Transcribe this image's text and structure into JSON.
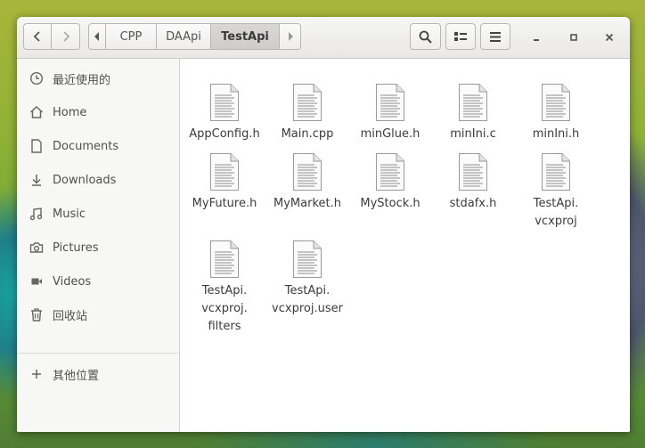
{
  "window": {
    "nav": {
      "back_icon": "chevron-left-icon",
      "forward_icon": "chevron-right-icon"
    },
    "path": [
      "CPP",
      "DAApi",
      "TestApi"
    ],
    "toolbar": {
      "search_icon": "search-icon",
      "view_icon": "list-view-icon",
      "menu_icon": "hamburger-menu-icon"
    },
    "controls": {
      "minimize_icon": "minimize-icon",
      "maximize_icon": "maximize-icon",
      "close_icon": "close-icon"
    }
  },
  "sidebar": {
    "items": [
      {
        "label": "最近使用的",
        "icon": "clock-icon"
      },
      {
        "label": "Home",
        "icon": "home-icon"
      },
      {
        "label": "Documents",
        "icon": "document-icon"
      },
      {
        "label": "Downloads",
        "icon": "download-icon"
      },
      {
        "label": "Music",
        "icon": "music-icon"
      },
      {
        "label": "Pictures",
        "icon": "camera-icon"
      },
      {
        "label": "Videos",
        "icon": "video-icon"
      },
      {
        "label": "回收站",
        "icon": "trash-icon"
      }
    ],
    "other": {
      "label": "其他位置",
      "icon": "plus-icon"
    }
  },
  "files": [
    {
      "lines": [
        "AppConfig.h"
      ]
    },
    {
      "lines": [
        "Main.cpp"
      ]
    },
    {
      "lines": [
        "minGlue.h"
      ]
    },
    {
      "lines": [
        "minIni.c"
      ]
    },
    {
      "lines": [
        "minIni.h"
      ]
    },
    {
      "lines": [
        "MyFuture.h"
      ]
    },
    {
      "lines": [
        "MyMarket.h"
      ]
    },
    {
      "lines": [
        "MyStock.h"
      ]
    },
    {
      "lines": [
        "stdafx.h"
      ]
    },
    {
      "lines": [
        "TestApi.",
        "vcxproj"
      ]
    },
    {
      "lines": [
        "TestApi.",
        "vcxproj.",
        "filters"
      ]
    },
    {
      "lines": [
        "TestApi.",
        "vcxproj.user"
      ]
    }
  ]
}
